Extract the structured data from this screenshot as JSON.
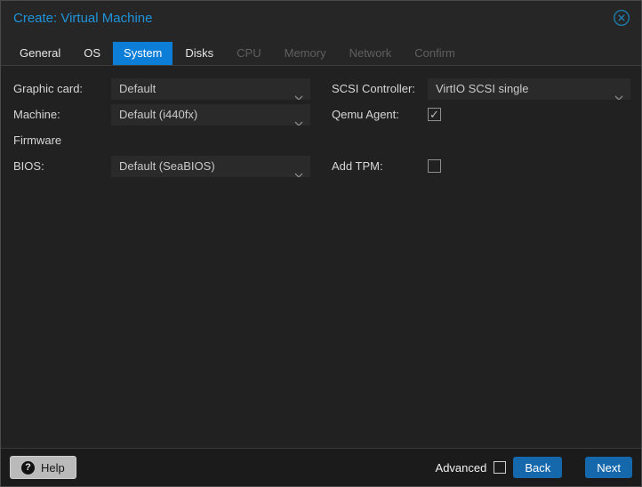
{
  "titlebar": {
    "title": "Create: Virtual Machine",
    "close_icon": "circle-x-icon"
  },
  "tabs": [
    {
      "label": "General",
      "state": "enabled"
    },
    {
      "label": "OS",
      "state": "enabled"
    },
    {
      "label": "System",
      "state": "active"
    },
    {
      "label": "Disks",
      "state": "enabled"
    },
    {
      "label": "CPU",
      "state": "disabled"
    },
    {
      "label": "Memory",
      "state": "disabled"
    },
    {
      "label": "Network",
      "state": "disabled"
    },
    {
      "label": "Confirm",
      "state": "disabled"
    }
  ],
  "form": {
    "left": [
      {
        "label": "Graphic card:",
        "value": "Default",
        "control": "select"
      },
      {
        "label": "Machine:",
        "value": "Default (i440fx)",
        "control": "select"
      },
      {
        "label": "Firmware",
        "control": "none"
      },
      {
        "label": "BIOS:",
        "value": "Default (SeaBIOS)",
        "control": "select"
      }
    ],
    "right": [
      {
        "label": "SCSI Controller:",
        "value": "VirtIO SCSI single",
        "control": "select"
      },
      {
        "label": "Qemu Agent:",
        "control": "checkbox",
        "checked": true,
        "glyph": "✓"
      },
      {
        "label": "Add TPM:",
        "control": "checkbox",
        "checked": false,
        "glyph": ""
      }
    ]
  },
  "footer": {
    "help_label": "Help",
    "help_icon_glyph": "?",
    "advanced_label": "Advanced",
    "advanced_checked": false,
    "back_label": "Back",
    "next_label": "Next"
  },
  "colors": {
    "active_tab_blue": "#0d7ed8",
    "button_blue": "#1468ab",
    "title_blue": "#1f93da",
    "dialog_background": "#212121"
  }
}
